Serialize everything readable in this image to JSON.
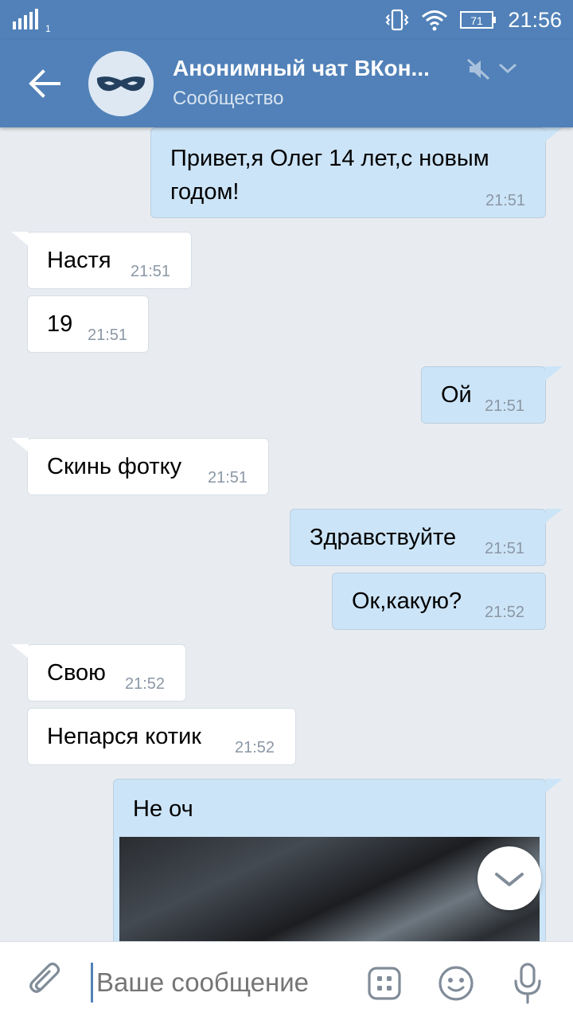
{
  "status_bar": {
    "signal_label": "1",
    "battery_level": "71",
    "time": "21:56"
  },
  "header": {
    "title": "Анонимный чат ВКон...",
    "subtitle": "Сообщество",
    "icons": [
      "back-arrow-icon",
      "mask-avatar-icon",
      "muted-speaker-icon",
      "chevron-down-icon"
    ]
  },
  "messages": [
    {
      "side": "out",
      "text_lines": [
        "Привет,я Олег 14 лет,с новым",
        "годом!"
      ],
      "time": "21:51"
    },
    {
      "side": "in",
      "text": "Настя",
      "time": "21:51"
    },
    {
      "side": "in",
      "text": "19",
      "time": "21:51"
    },
    {
      "side": "out",
      "text": "Ой",
      "time": "21:51"
    },
    {
      "side": "in",
      "text": "Скинь фотку",
      "time": "21:51"
    },
    {
      "side": "out",
      "text": "Здравствуйте",
      "time": "21:51"
    },
    {
      "side": "out",
      "text": "Ок,какую?",
      "time": "21:52"
    },
    {
      "side": "in",
      "text": "Свою",
      "time": "21:52"
    },
    {
      "side": "in",
      "text": "Непарся котик",
      "time": "21:52"
    },
    {
      "side": "out",
      "text": "Не оч",
      "has_photo": true
    }
  ],
  "composer": {
    "placeholder": "Ваше сообщение",
    "icons": [
      "attach-icon",
      "stickers-icon",
      "emoji-icon",
      "microphone-icon"
    ]
  },
  "colors": {
    "header": "#5181b8",
    "background": "#e8ecf0",
    "outgoing_bubble": "#cce4f7",
    "incoming_bubble": "#ffffff"
  }
}
